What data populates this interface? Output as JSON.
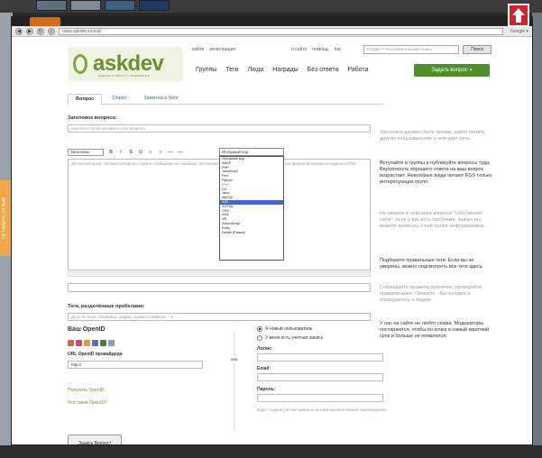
{
  "browser": {
    "url": "www.askdev.ru/ask/",
    "nav_right": "Google ▾"
  },
  "side_tab": {
    "label": "ОСТАВИТЬ ОТЗЫВ"
  },
  "site": {
    "logo_text": "askdev",
    "logo_tagline": "вопросы и ответы IT-специалистов"
  },
  "toplinks": {
    "login": "войти",
    "register": "регистрация",
    "about": "о сайте",
    "help": "помощь",
    "faq": "faq"
  },
  "search": {
    "placeholder": "Google™ Пользовательский поиск",
    "button": "Поиск"
  },
  "mainnav": [
    "Группы",
    "Теги",
    "Люди",
    "Награды",
    "Без ответа",
    "Работа"
  ],
  "ask_button": "Задать вопрос »",
  "tabs": [
    "Вопрос",
    "Опрос",
    "Заметка в блог"
  ],
  "form": {
    "title_label": "Заголовок вопроса:",
    "title_placeholder": "коротко и четко изложите суть вопроса",
    "toolbar_select": "Заголовок",
    "toolbar_icons": [
      "B",
      "I",
      "S",
      "U",
      "≡",
      "≡",
      "—",
      "—"
    ],
    "lang_selected": "Исходный код",
    "editor_placeholder": "Детали вопроса. Лучшая исходного кода и сообщения об ошибках. Используйте разметку с помощью инструментов форматирования исходного HTML.",
    "lang_options": [
      "Исходный код",
      "ABAP",
      "PHP",
      "JavaScript",
      "Perl",
      "Python",
      "C++",
      "C#",
      "Java",
      "MySQL",
      "SQL",
      "XHTML",
      "CSS",
      "XML",
      "VB",
      "ActionScript",
      "Ruby",
      "Delphi (Pascal)"
    ],
    "lang_highlight_index": 10,
    "tags_label": "Теги, разделённые пробелами:",
    "tags_placeholder": "До 5-ти тегов. Латиница, цифры, буквы и символы + # . -",
    "openid_title": "Ваш OpenID",
    "openid_url_label": "URL OpenID провайдера",
    "openid_url_value": "http://",
    "get_openid": "Получить OpenID",
    "what_openid": "Что такое OpenID?",
    "or": "или",
    "radio_new": "Я новый пользователь",
    "radio_existing": "У меня есть учетная запись",
    "name_label": "Логин:",
    "email_label": "Email:",
    "password_label": "Пароль:",
    "email_note": "Будет создана учетная запись и на email выслано письмо подтверждения",
    "submit": "Задать Вопрос!"
  },
  "sidebar": {
    "p1": "Заголовок должен быть четким, дайте понять другим пользователям о чем идет речь",
    "p2": "Вступайте в группы и публикуйте вопросы туда. Вероятность хорошего ответа на ваш вопрос возрастает. Некоторые люди читают RSS только интересующих групп.",
    "p3": "Не пишите в описании вопроса \"собственно сабж\", если у вас есть проблема, значит вы можете написать о ней более информативно.",
    "p4": "Подберите правильные теги. Если вы не уверены, можно подсмотреть все теги здесь.",
    "p5": "Соблюдайте правила приличия, проверяйте правописание. Помните - Вы человек и обращаетесь к людям.",
    "p6": "У нас на сайте не любят спама. Модераторы постараются, чтобы он исчез в самый короткий срок и больше не появлялся."
  },
  "colors": {
    "brand_green": "#6f8f2d",
    "ask_button": "#4e8f2c",
    "side_tab": "#f0a64a",
    "red_button": "#d3202a",
    "highlight": "#3d6cc4"
  }
}
